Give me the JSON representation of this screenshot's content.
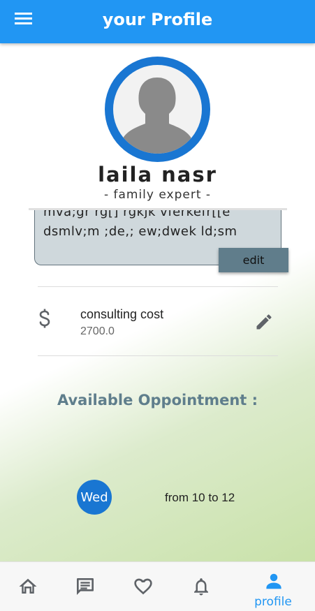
{
  "appbar": {
    "title": "your Profile",
    "menu_icon": "menu-icon"
  },
  "profile": {
    "name": "laila nasr",
    "role": "- family expert -",
    "bio_lines": [
      "mva;gr rg[]  rgkjk vferkefr[[e",
      "dsmlv;m ;de,; ew;dwek ld;sm"
    ],
    "edit_label": "edit"
  },
  "consulting": {
    "title": "consulting cost",
    "value": "2700.0",
    "icon": "dollar-icon",
    "action_icon": "edit-pencil-icon"
  },
  "availability": {
    "title": "Available Oppointment :",
    "slots": [
      {
        "day": "Wed",
        "time": "from 10 to 12"
      }
    ]
  },
  "bottom_nav": {
    "items": [
      {
        "icon": "home-icon",
        "label": ""
      },
      {
        "icon": "chat-icon",
        "label": ""
      },
      {
        "icon": "heart-icon",
        "label": ""
      },
      {
        "icon": "bell-icon",
        "label": ""
      },
      {
        "icon": "person-icon",
        "label": "profile",
        "active": true
      }
    ]
  },
  "colors": {
    "primary": "#2196f3",
    "avatar_ring": "#1976d2",
    "edit_button": "#607d8b",
    "bio_background": "#cfd8dc",
    "heading": "#5f7e8c",
    "inactive_icon": "#5f6368"
  }
}
